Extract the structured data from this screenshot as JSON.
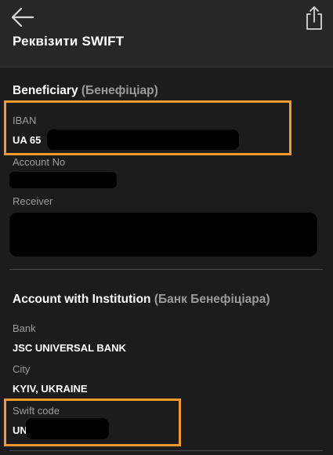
{
  "header": {
    "title": "Реквізити SWIFT",
    "back_icon": "arrow-left-icon",
    "share_icon": "share-icon"
  },
  "beneficiary": {
    "title": "Beneficiary",
    "subtitle": "(Бенефіціар)",
    "iban_label": "IBAN",
    "iban_value": "UA 65",
    "account_label": "Account No",
    "receiver_label": "Receiver"
  },
  "institution": {
    "title": "Account with Institution",
    "subtitle": "(Банк Бенефіціара)",
    "bank_label": "Bank",
    "bank_value": "JSC UNIVERSAL BANK",
    "city_label": "City",
    "city_value": "KYIV, UKRAINE",
    "swift_label": "Swift code",
    "swift_value": "UN"
  },
  "colors": {
    "background": "#1c1c1e",
    "header_background": "#272729",
    "highlight": "#f19a2b",
    "label": "#9c9ca2",
    "redaction": "#000000"
  }
}
